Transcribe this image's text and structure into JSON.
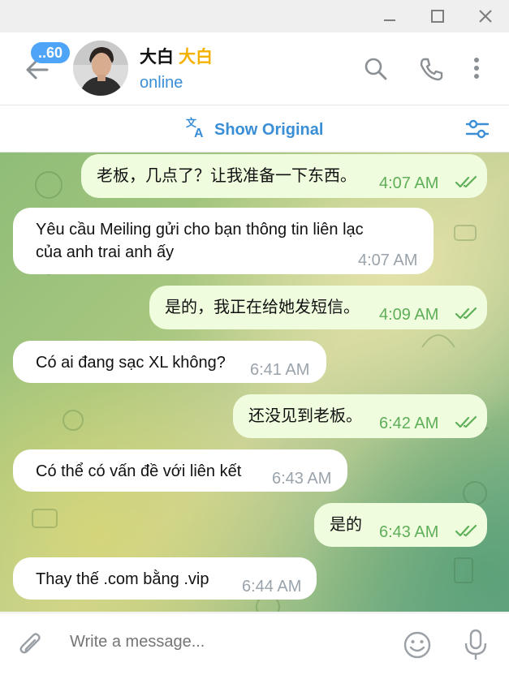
{
  "window": {
    "controls": [
      "minimize-icon",
      "maximize-icon",
      "close-icon"
    ]
  },
  "header": {
    "unread_badge": "..60",
    "contact_name": "大白",
    "name_tag": "大白",
    "status": "online",
    "icons": [
      "back-arrow-icon",
      "search-icon",
      "phone-icon",
      "more-vertical-icon"
    ]
  },
  "translate_bar": {
    "label": "Show Original",
    "icons": [
      "translate-icon",
      "settings-sliders-icon"
    ]
  },
  "messages": [
    {
      "dir": "out",
      "text": "老板，几点了？让我准备一下东西。",
      "time": "4:07 AM",
      "read": true
    },
    {
      "dir": "in",
      "text": "Yêu cầu Meiling gửi cho bạn thông tin liên lạc\ncủa anh trai anh ấy",
      "time": "4:07 AM"
    },
    {
      "dir": "out",
      "text": "是的，我正在给她发短信。",
      "time": "4:09 AM",
      "read": true
    },
    {
      "dir": "in",
      "text": "Có ai đang sạc XL không?",
      "time": "6:41 AM"
    },
    {
      "dir": "out",
      "text": "还没见到老板。",
      "time": "6:42 AM",
      "read": true
    },
    {
      "dir": "in",
      "text": "Có thể có vấn đề với liên kết",
      "time": "6:43 AM"
    },
    {
      "dir": "out",
      "text": "是的",
      "time": "6:43 AM",
      "read": true
    },
    {
      "dir": "in",
      "text": "Thay thế .com bằng .vip",
      "time": "6:44 AM"
    }
  ],
  "composer": {
    "placeholder": "Write a message...",
    "icons": [
      "attach-icon",
      "emoji-icon",
      "microphone-icon"
    ]
  },
  "colors": {
    "accent": "#3a8ed6",
    "badge": "#4ea4f6",
    "outgoing_bubble": "#effdde",
    "incoming_bubble": "#ffffff",
    "read_check": "#5fae59",
    "name_tag": "#f5b100"
  }
}
